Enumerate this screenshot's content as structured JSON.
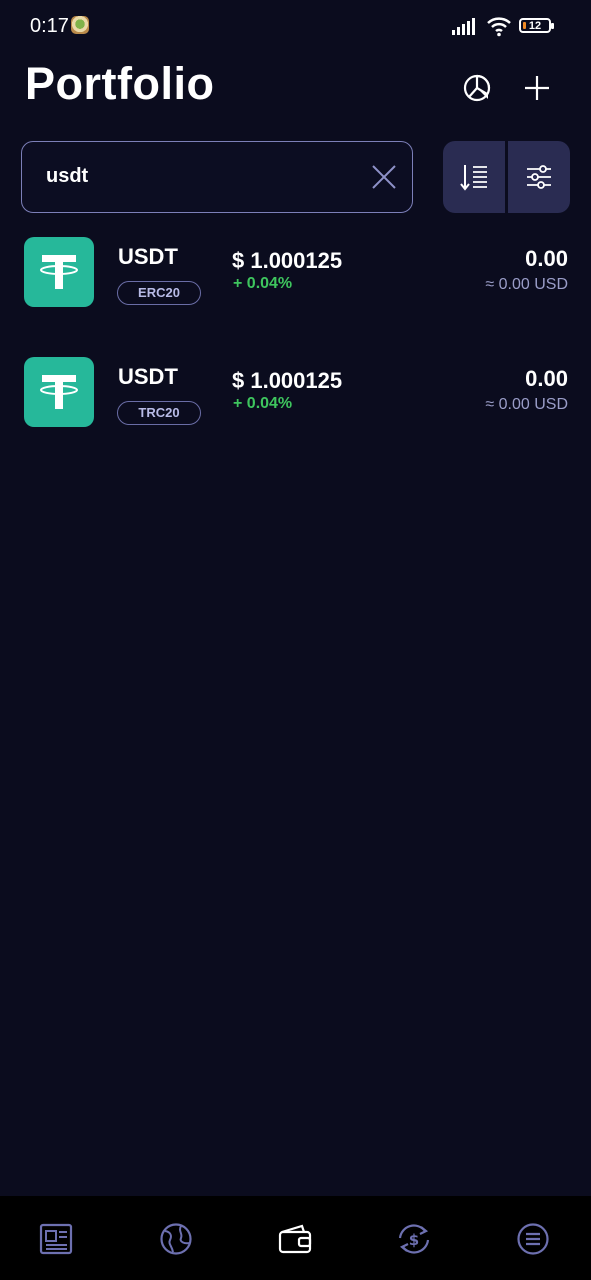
{
  "status_bar": {
    "time": "0:17",
    "battery_level": "12",
    "icons": [
      "app-notification-icon",
      "signal-icon",
      "wifi-icon",
      "battery-icon"
    ]
  },
  "header": {
    "title": "Portfolio",
    "actions": [
      "portfolio-chart-icon",
      "plus-icon"
    ]
  },
  "search": {
    "value": "usdt",
    "placeholder": ""
  },
  "tokens": [
    {
      "symbol": "USDT",
      "network": "ERC20",
      "price": "$ 1.000125",
      "change": "+ 0.04%",
      "balance": "0.00",
      "fiat_value": "≈ 0.00 USD"
    },
    {
      "symbol": "USDT",
      "network": "TRC20",
      "price": "$ 1.000125",
      "change": "+ 0.04%",
      "balance": "0.00",
      "fiat_value": "≈ 0.00 USD"
    }
  ],
  "bottom_nav": {
    "items": [
      "news-icon",
      "globe-icon",
      "wallet-icon",
      "swap-icon",
      "menu-icon"
    ],
    "active": "wallet-icon"
  },
  "colors": {
    "background": "#0b0c1e",
    "accent": "#7c7fb8",
    "tether_green": "#26b89a",
    "positive": "#3ec55e",
    "tool_bg": "#2a2c52"
  }
}
